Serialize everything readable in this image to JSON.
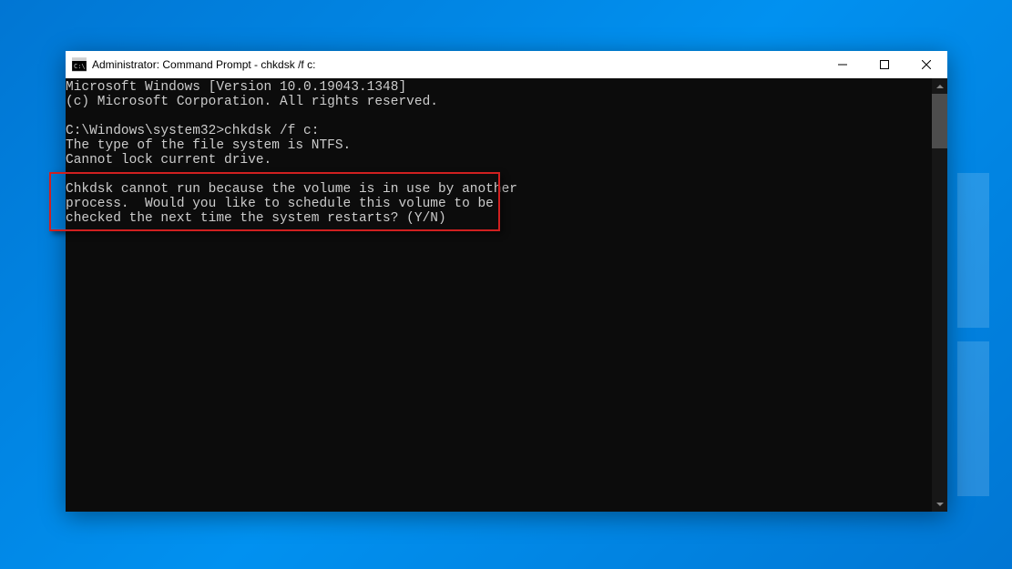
{
  "titlebar": {
    "title": "Administrator: Command Prompt - chkdsk  /f c:"
  },
  "terminal": {
    "line1": "Microsoft Windows [Version 10.0.19043.1348]",
    "line2": "(c) Microsoft Corporation. All rights reserved.",
    "blank1": "",
    "prompt": "C:\\Windows\\system32>chkdsk /f c:",
    "line3": "The type of the file system is NTFS.",
    "line4": "Cannot lock current drive.",
    "blank2": "",
    "msg1": "Chkdsk cannot run because the volume is in use by another",
    "msg2": "process.  Would you like to schedule this volume to be",
    "msg3": "checked the next time the system restarts? (Y/N)"
  }
}
